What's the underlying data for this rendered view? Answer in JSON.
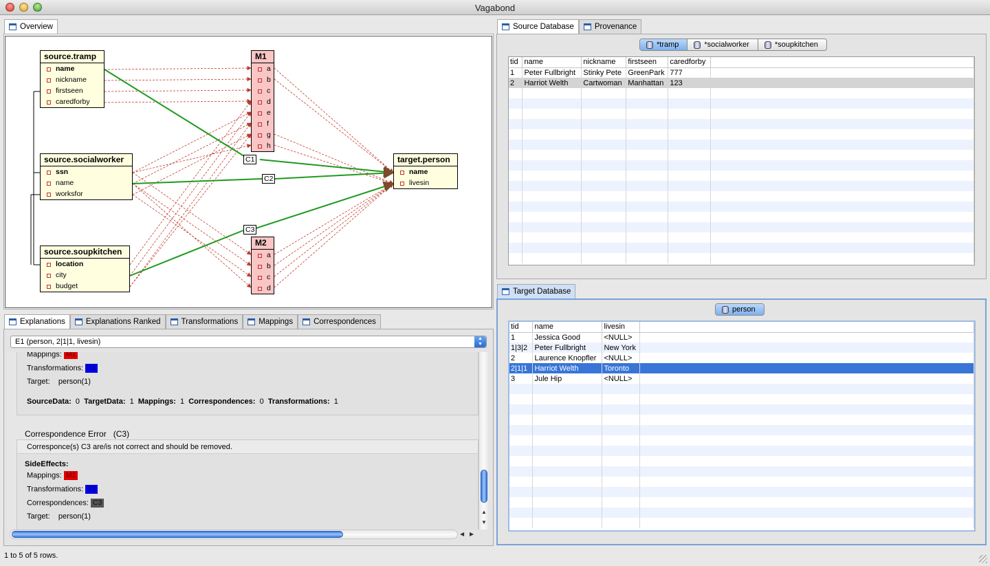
{
  "window": {
    "title": "Vagabond"
  },
  "overview": {
    "tab": "Overview",
    "boxes": {
      "tramp": {
        "title": "source.tramp",
        "attrs": [
          "name",
          "nickname",
          "firstseen",
          "caredforby"
        ]
      },
      "socialworker": {
        "title": "source.socialworker",
        "attrs": [
          "ssn",
          "name",
          "worksfor"
        ]
      },
      "soupkitchen": {
        "title": "source.soupkitchen",
        "attrs": [
          "location",
          "city",
          "budget"
        ]
      },
      "m1": {
        "title": "M1",
        "attrs": [
          "a",
          "b",
          "c",
          "d",
          "e",
          "f",
          "g",
          "h"
        ]
      },
      "m2": {
        "title": "M2",
        "attrs": [
          "a",
          "b",
          "c",
          "d"
        ]
      },
      "target": {
        "title": "target.person",
        "attrs": [
          "name",
          "livesin"
        ]
      }
    },
    "correspondences": [
      "C1",
      "C2",
      "C3"
    ],
    "colors": {
      "correspondence": "#1e9a1e",
      "mapping": "#c0392b",
      "source_box": "#ffffe0",
      "mapping_box": "#f9c5c5"
    }
  },
  "bottom_tabs": [
    "Explanations",
    "Explanations Ranked",
    "Transformations",
    "Mappings",
    "Correspondences"
  ],
  "explanations": {
    "selected": "E1 (person, 2|1|1, livesin)",
    "first": {
      "mappings_label": "Mappings:",
      "mappings_tag": "M1",
      "transformations_label": "Transformations:",
      "transformations_tag": "T1",
      "target_label": "Target:",
      "target_value": "person(1)",
      "summary": [
        {
          "label": "SourceData:",
          "value": "0"
        },
        {
          "label": "TargetData:",
          "value": "1"
        },
        {
          "label": "Mappings:",
          "value": "1"
        },
        {
          "label": "Correspondences:",
          "value": "0"
        },
        {
          "label": "Transformations:",
          "value": "1"
        }
      ]
    },
    "second": {
      "heading": "Correspondence Error",
      "heading_id": "(C3)",
      "description": "Corresponce(s) C3 are/is not correct and should be removed.",
      "side_effects_label": "SideEffects:",
      "mappings_label": "Mappings:",
      "mappings_tag": "M1",
      "transformations_label": "Transformations:",
      "transformations_tag": "T1",
      "correspondences_label": "Correspondences:",
      "correspondences_tag": "C3",
      "target_label": "Target:",
      "target_value": "person(1)"
    }
  },
  "source_db": {
    "tabs": [
      "Source Database",
      "Provenance"
    ],
    "segments": [
      "*tramp",
      "*socialworker",
      "*soupkitchen"
    ],
    "columns": [
      "tid",
      "name",
      "nickname",
      "firstseen",
      "caredforby"
    ],
    "rows": [
      [
        "1",
        "Peter Fullbright",
        "Stinky Pete",
        "GreenPark",
        "777"
      ],
      [
        "2",
        "Harriot Welth",
        "Cartwoman",
        "Manhattan",
        "123"
      ]
    ]
  },
  "target_db": {
    "tab": "Target Database",
    "segments": [
      "person"
    ],
    "columns": [
      "tid",
      "name",
      "livesin"
    ],
    "rows": [
      [
        "1",
        "Jessica Good",
        "<NULL>"
      ],
      [
        "1|3|2",
        "Peter Fullbright",
        "New York"
      ],
      [
        "2",
        "Laurence Knopfler",
        "<NULL>"
      ],
      [
        "2|1|1",
        "Harriot Welth",
        "Toronto"
      ],
      [
        "3",
        "Jule Hip",
        "<NULL>"
      ]
    ]
  },
  "status": "1 to 5 of 5 rows."
}
